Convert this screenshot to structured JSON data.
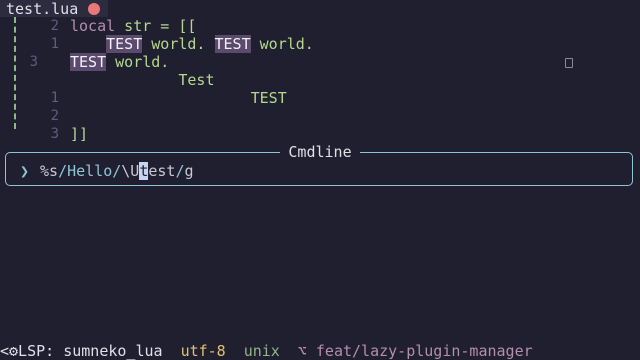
{
  "tab": {
    "filename": "test.lua"
  },
  "editor": {
    "lines": [
      {
        "num": "2",
        "parts": [
          {
            "t": "local",
            "c": "kw"
          },
          {
            "t": " str = [[",
            "c": "str"
          }
        ]
      },
      {
        "num": "1",
        "parts": [
          {
            "t": "    ",
            "c": ""
          },
          {
            "t": "TEST",
            "c": "hl"
          },
          {
            "t": " world. ",
            "c": "str"
          },
          {
            "t": "TEST",
            "c": "hl"
          },
          {
            "t": " world.",
            "c": "str"
          }
        ]
      },
      {
        "num": "3",
        "parts": [
          {
            "t": "TEST",
            "c": "hl"
          },
          {
            "t": " world.",
            "c": "str"
          }
        ]
      },
      {
        "num": "",
        "parts": [
          {
            "t": "            Test",
            "c": "str"
          }
        ]
      },
      {
        "num": "1",
        "parts": [
          {
            "t": "                    TEST",
            "c": "str"
          }
        ]
      },
      {
        "num": "2",
        "parts": [
          {
            "t": "",
            "c": ""
          }
        ]
      },
      {
        "num": "3",
        "parts": [
          {
            "t": "]]",
            "c": "str"
          }
        ]
      }
    ]
  },
  "cmdline": {
    "title": "Cmdline",
    "prefix": "%s",
    "sep1": "/",
    "pattern": "Hello",
    "sep2": "/",
    "repl_pre": "\\U",
    "cursor_char": "t",
    "repl_post": "est",
    "sep3": "/",
    "flags": "g"
  },
  "statusbar": {
    "lsp": "<⚙LSP: sumneko_lua",
    "encoding": "utf-8",
    "fileformat": "unix",
    "branch": "⌥ feat/lazy-plugin-manager"
  },
  "colors": {
    "background": "#1f1f2f",
    "accent": "#8fc4d6",
    "string": "#b5d88f",
    "keyword": "#b48ead",
    "highlight": "#5b4a6e"
  }
}
